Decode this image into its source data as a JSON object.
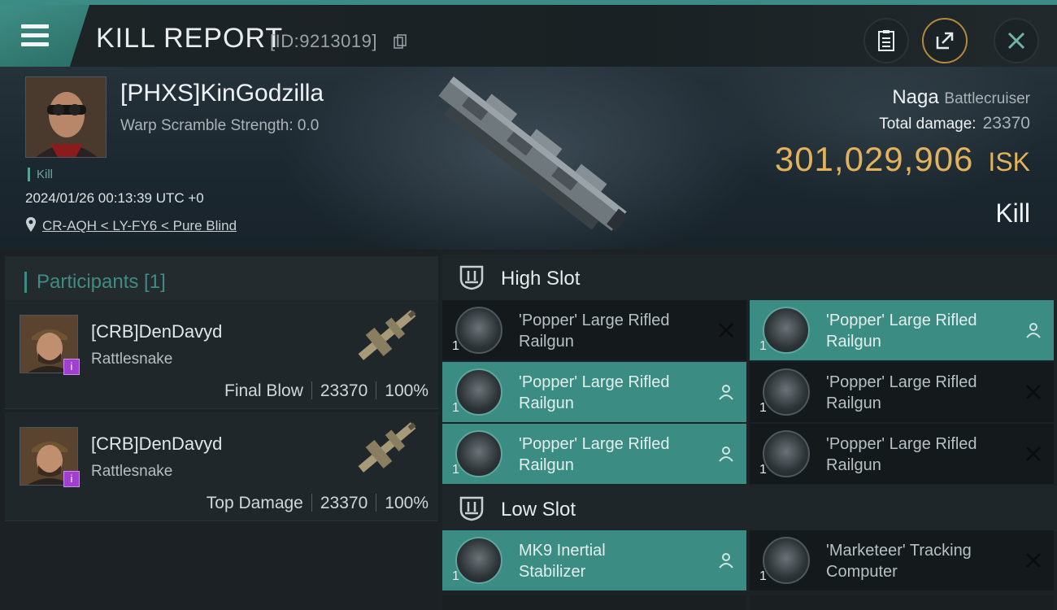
{
  "header": {
    "title": "KILL REPORT",
    "id_label": "[ID:9213019]"
  },
  "victim": {
    "name": "[PHXS]KinGodzilla",
    "warp_scramble": "Warp Scramble Strength: 0.0",
    "kill_tag": "Kill",
    "timestamp": "2024/01/26 00:13:39 UTC +0",
    "location": "CR-AQH < LY-FY6 < Pure Blind",
    "ship_name": "Naga",
    "ship_class": "Battlecruiser",
    "total_damage_label": "Total damage:",
    "total_damage": "23370",
    "isk_value": "301,029,906",
    "isk_unit": "ISK",
    "result": "Kill"
  },
  "participants": {
    "header": "Participants [1]",
    "items": [
      {
        "name": "[CRB]DenDavyd",
        "ship": "Rattlesnake",
        "role": "Final Blow",
        "damage": "23370",
        "percent": "100%",
        "badge": "i"
      },
      {
        "name": "[CRB]DenDavyd",
        "ship": "Rattlesnake",
        "role": "Top Damage",
        "damage": "23370",
        "percent": "100%",
        "badge": "i"
      }
    ]
  },
  "fitting": {
    "high_slot_title": "High Slot",
    "low_slot_title": "Low Slot",
    "high_slots": [
      {
        "name1": "'Popper' Large Rifled",
        "name2": "Railgun",
        "qty": "1",
        "state": "destroyed"
      },
      {
        "name1": "'Popper' Large Rifled",
        "name2": "Railgun",
        "qty": "1",
        "state": "dropped"
      },
      {
        "name1": "'Popper' Large Rifled",
        "name2": "Railgun",
        "qty": "1",
        "state": "dropped"
      },
      {
        "name1": "'Popper' Large Rifled",
        "name2": "Railgun",
        "qty": "1",
        "state": "destroyed"
      },
      {
        "name1": "'Popper' Large Rifled",
        "name2": "Railgun",
        "qty": "1",
        "state": "dropped"
      },
      {
        "name1": "'Popper' Large Rifled",
        "name2": "Railgun",
        "qty": "1",
        "state": "destroyed"
      }
    ],
    "low_slots": [
      {
        "name1": "MK9 Inertial",
        "name2": "Stabilizer",
        "qty": "1",
        "state": "dropped"
      },
      {
        "name1": "'Marketeer' Tracking",
        "name2": "Computer",
        "qty": "1",
        "state": "destroyed"
      }
    ]
  },
  "colors": {
    "accent_teal": "#3b8c82",
    "isk_gold": "#e3b25a",
    "badge_purple": "#a13fd0"
  }
}
